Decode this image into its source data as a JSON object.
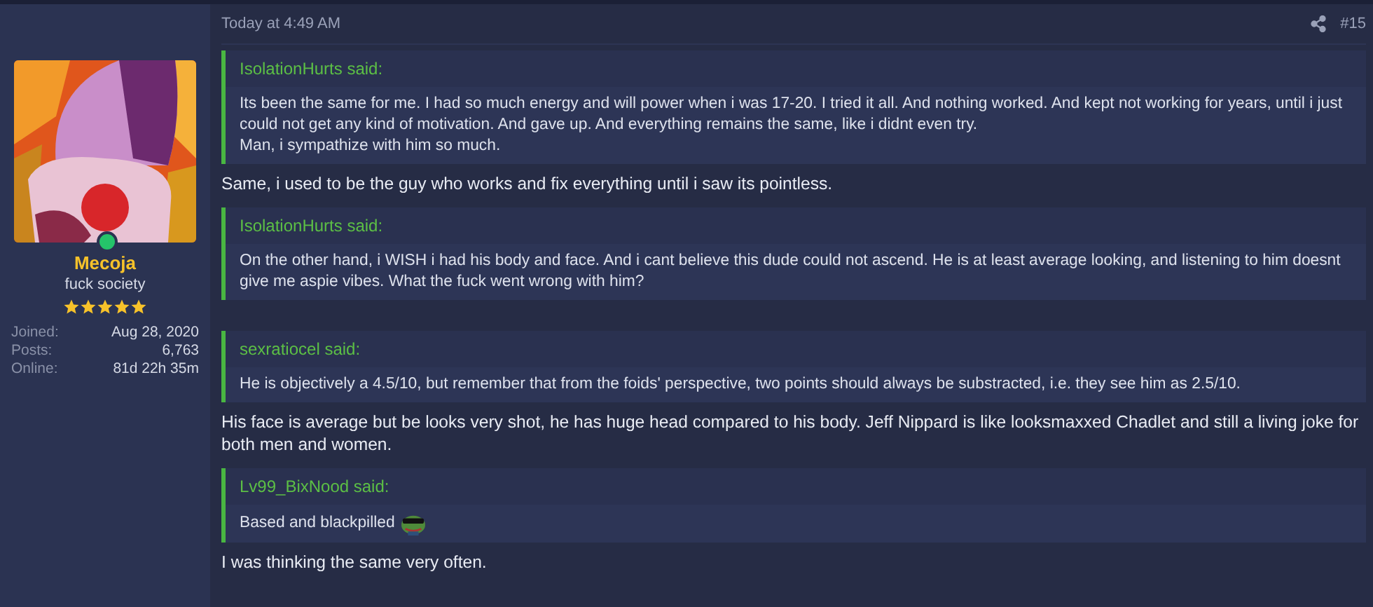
{
  "user": {
    "name": "Mecoja",
    "title": "fuck society",
    "online": true,
    "stars": 5,
    "stats": [
      {
        "label": "Joined:",
        "value": "Aug 28, 2020"
      },
      {
        "label": "Posts:",
        "value": "6,763"
      },
      {
        "label": "Online:",
        "value": "81d 22h 35m"
      }
    ]
  },
  "post": {
    "time": "Today at 4:49 AM",
    "number": "#15",
    "blocks": [
      {
        "kind": "quote",
        "author": "IsolationHurts said:",
        "lines": [
          "Its been the same for me. I had so much energy and will power when i was 17-20. I tried it all. And nothing worked. And kept not working for years, until i just could not get any kind of motivation. And gave up. And everything remains the same, like i didnt even try.",
          "Man, i sympathize with him so much."
        ]
      },
      {
        "kind": "text",
        "text": "Same, i used to be the guy who works and fix everything until i saw its pointless."
      },
      {
        "kind": "quote",
        "author": "IsolationHurts said:",
        "lines": [
          "On the other hand, i WISH i had his body and face. And i cant believe this dude could not ascend. He is at least average looking, and listening to him doesnt give me aspie vibes. What the fuck went wrong with him?"
        ]
      },
      {
        "kind": "quote",
        "author": "sexratiocel said:",
        "lines": [
          "He is objectively a 4.5/10, but remember that from the foids' perspective, two points should always be substracted, i.e. they see him as 2.5/10."
        ]
      },
      {
        "kind": "text",
        "text": "His face is average but be looks very shot, he has huge head compared to his body. Jeff Nippard is like looksmaxxed Chadlet and still a living joke for both men and women."
      },
      {
        "kind": "quote",
        "author": "Lv99_BixNood said:",
        "lines": [
          "Based and blackpilled"
        ],
        "emoji": true
      },
      {
        "kind": "text",
        "text": "I was thinking the same very often."
      }
    ]
  }
}
